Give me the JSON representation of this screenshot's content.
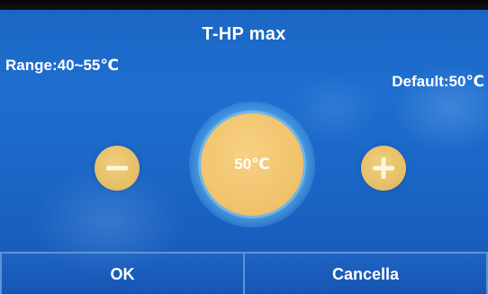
{
  "header": {
    "title": "T-HP max"
  },
  "info": {
    "range": "Range:40~55℃",
    "default": "Default:50℃"
  },
  "dial": {
    "value": "50℃"
  },
  "controls": {
    "decrease_icon": "minus-icon",
    "increase_icon": "plus-icon"
  },
  "footer": {
    "ok_label": "OK",
    "cancel_label": "Cancella"
  },
  "colors": {
    "background": "#1e6fd0",
    "button_gold": "#f1c46e",
    "text": "#ffffff"
  }
}
